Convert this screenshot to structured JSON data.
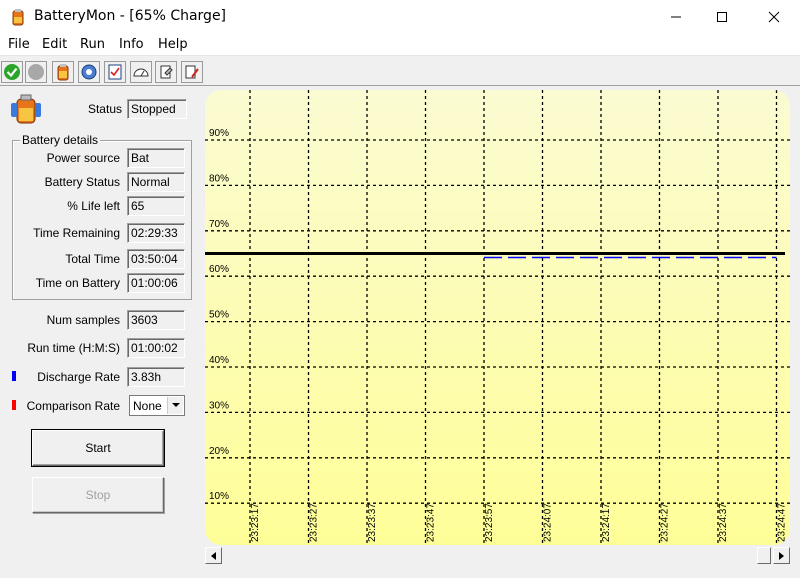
{
  "window": {
    "title": "BatteryMon - [65% Charge]"
  },
  "menu": [
    {
      "label": "File"
    },
    {
      "label": "Edit"
    },
    {
      "label": "Run"
    },
    {
      "label": "Info"
    },
    {
      "label": "Help"
    }
  ],
  "toolbar": [
    {
      "icon": "green-check-icon",
      "name": "start"
    },
    {
      "icon": "gray-circle-icon",
      "name": "stop"
    },
    {
      "icon": "battery-icon",
      "name": "battery-info"
    },
    {
      "icon": "globe-gear-icon",
      "name": "options"
    },
    {
      "icon": "checklist-icon",
      "name": "log"
    },
    {
      "icon": "gauge-icon",
      "name": "meter"
    },
    {
      "icon": "help-hand-icon",
      "name": "help"
    },
    {
      "icon": "tools-icon",
      "name": "settings"
    }
  ],
  "status": {
    "label": "Status",
    "value": "Stopped"
  },
  "battery_details": {
    "title": "Battery details",
    "power_source": {
      "label": "Power source",
      "value": "Bat"
    },
    "battery_status": {
      "label": "Battery Status",
      "value": "Normal"
    },
    "life_left": {
      "label": "% Life left",
      "value": "65"
    },
    "time_remaining": {
      "label": "Time Remaining",
      "value": "02:29:33"
    },
    "total_time": {
      "label": "Total Time",
      "value": "03:50:04"
    },
    "time_on_battery": {
      "label": "Time on Battery",
      "value": "01:00:06"
    }
  },
  "num_samples": {
    "label": "Num samples",
    "value": "3603"
  },
  "run_time": {
    "label": "Run time (H:M:S)",
    "value": "01:00:02"
  },
  "discharge_rate": {
    "label": "Discharge Rate",
    "value": "3.83h",
    "color": "#0000ff"
  },
  "comparison_rate": {
    "label": "Comparison Rate",
    "value": "None",
    "color": "#ff0000"
  },
  "buttons": {
    "start": "Start",
    "stop": "Stop"
  },
  "colors": {
    "chart_top": "#fbfbd2",
    "chart_bottom": "#fefe98",
    "charge_line": "#000000",
    "discharge_line": "#0000ff"
  },
  "chart_data": {
    "type": "line",
    "y_ticks": [
      "90%",
      "80%",
      "70%",
      "60%",
      "50%",
      "40%",
      "30%",
      "20%",
      "10%"
    ],
    "x_ticks": [
      "23:23:17",
      "23:23:27",
      "23:23:37",
      "23:23:47",
      "23:23:57",
      "23:24:07",
      "23:24:17",
      "23:24:27",
      "23:24:37",
      "23:24:47"
    ],
    "ylim": [
      10,
      90
    ],
    "grid": true,
    "series": [
      {
        "color": "#000000",
        "style": "solid",
        "x": [
          "23:23:17",
          "23:24:47"
        ],
        "values": [
          65,
          65
        ]
      },
      {
        "color": "#0000ff",
        "style": "dashed",
        "x": [
          "23:23:57",
          "23:24:47"
        ],
        "values": [
          65,
          65
        ]
      }
    ]
  }
}
